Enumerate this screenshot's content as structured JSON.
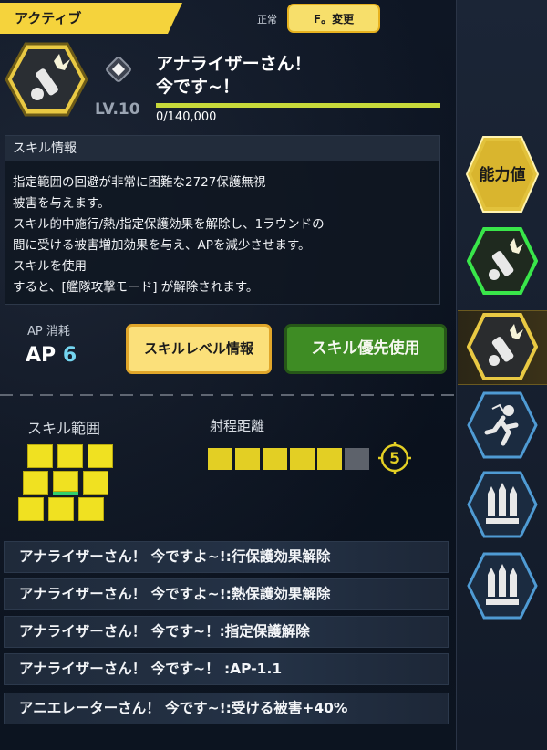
{
  "header": {
    "active_tab": "アクティブ",
    "mode_label": "正常",
    "change_button": "F。変更"
  },
  "skill": {
    "title": "アナライザーさん！\n今です~！",
    "level": "LV.10",
    "exp": "0/140,000",
    "exp_fraction": 0.0
  },
  "info": {
    "header": "スキル情報",
    "lines": [
      "指定範囲の回避が非常に困難な2727保護無視",
      "被害を与えます。",
      "スキル的中施行/熱/指定保護効果を解除し、1ラウンドの",
      "間に受ける被害増加効果を与え、APを減少させます。",
      "スキルを使用",
      "すると、[艦隊攻撃モード] が解除されます。"
    ]
  },
  "ap": {
    "label": "AP 消耗",
    "prefix": "AP",
    "value": "6"
  },
  "buttons": {
    "level_info": "スキルレベル情報",
    "priority": "スキル優先使用"
  },
  "range": {
    "label": "スキル範囲",
    "distance_label": "射程距離",
    "distance_value": "5",
    "distance_filled": 5,
    "distance_total": 6
  },
  "effects": [
    "アナライザーさん！ 今ですよ~!:行保護効果解除",
    "アナライザーさん！ 今ですよ~!:熱保護効果解除",
    "アナライザーさん！ 今です~！:指定保護解除",
    "アナライザーさん！ 今です~！ :AP-1.1",
    "アニエレーターさん！ 今です~!:受ける被害+40%"
  ],
  "sidebar": {
    "stats_label": "能力値",
    "items": [
      {
        "icon": "rocket-launcher-icon",
        "state": "equipped-green"
      },
      {
        "icon": "rocket-launcher-icon",
        "state": "selected"
      },
      {
        "icon": "running-figure-icon",
        "state": "normal"
      },
      {
        "icon": "missiles-icon",
        "state": "normal"
      },
      {
        "icon": "missiles-icon",
        "state": "normal"
      }
    ]
  },
  "colors": {
    "accent_yellow": "#f5d33c",
    "green_button": "#3e8c24",
    "ap_blue": "#74d5f0"
  }
}
